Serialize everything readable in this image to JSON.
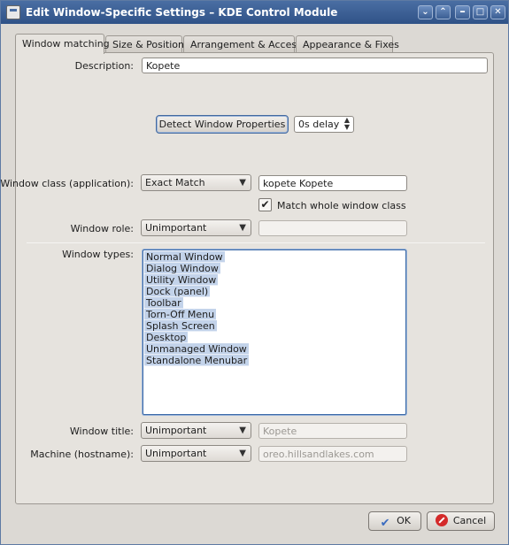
{
  "window": {
    "title": "Edit Window-Specific Settings – KDE Control Module",
    "buttons": {
      "min_glyph": "⌄",
      "menu_glyph": "⌃",
      "max_glyph": "□",
      "close_glyph": "✕"
    }
  },
  "tabs": [
    {
      "label": "Window matching",
      "active": true
    },
    {
      "label": "Size & Position"
    },
    {
      "label": "Arrangement & Access"
    },
    {
      "label": "Appearance & Fixes"
    }
  ],
  "form": {
    "description": {
      "label": "Description:",
      "value": "Kopete"
    },
    "detect_button": "Detect Window Properties",
    "delay": {
      "value": "0s delay"
    },
    "window_class": {
      "label": "Window class (application):",
      "match": "Exact Match",
      "value": "kopete Kopete"
    },
    "match_whole": {
      "label": "Match whole window class",
      "checked": true,
      "check_glyph": "✔"
    },
    "window_role": {
      "label": "Window role:",
      "match": "Unimportant",
      "value": ""
    },
    "window_types": {
      "label": "Window types:",
      "items": [
        "Normal Window",
        "Dialog Window",
        "Utility Window",
        "Dock (panel)",
        "Toolbar",
        "Torn-Off Menu",
        "Splash Screen",
        "Desktop",
        "Unmanaged Window",
        "Standalone Menubar"
      ]
    },
    "window_title": {
      "label": "Window title:",
      "match": "Unimportant",
      "value": "Kopete"
    },
    "machine": {
      "label": "Machine (hostname):",
      "match": "Unimportant",
      "value": "oreo.hillsandlakes.com"
    },
    "combo_arrow": "▼",
    "spin_up": "▲",
    "spin_down": "▼"
  },
  "footer": {
    "ok_label": "OK",
    "cancel_label": "Cancel",
    "ok_icon_glyph": "✔"
  }
}
